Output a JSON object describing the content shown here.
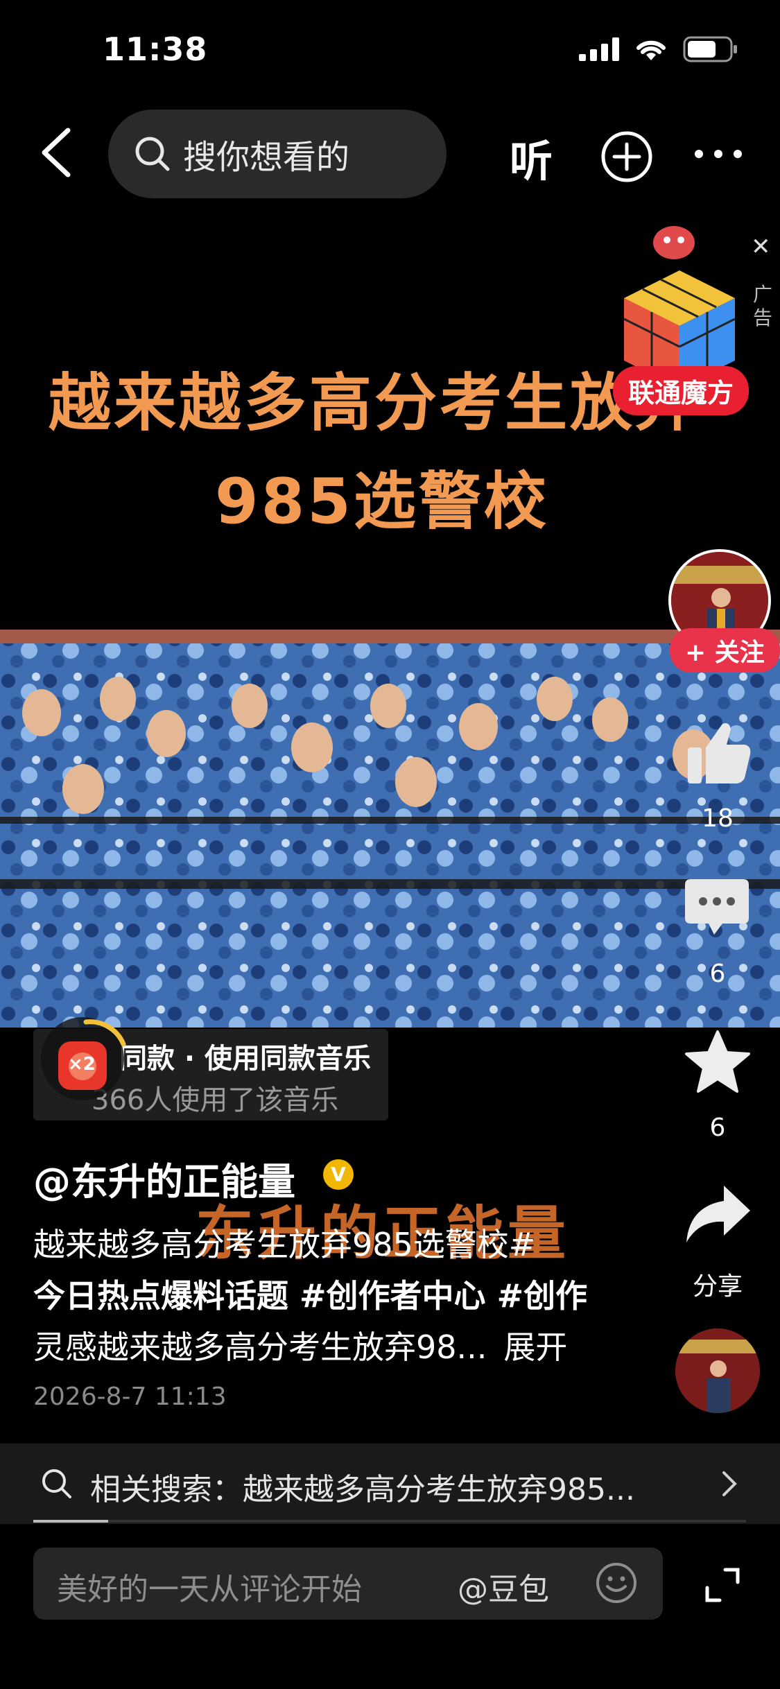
{
  "status": {
    "time": "11:38"
  },
  "nav": {
    "search_placeholder": "搜你想看的",
    "listen_label": "听"
  },
  "video": {
    "headline_line1": "越来越多高分考生放弃",
    "headline_line2": "985选警校"
  },
  "ad": {
    "brand": "联通魔方",
    "tag": "广告"
  },
  "rail": {
    "follow_label": "+ 关注",
    "like_count": "18",
    "comment_count": "6",
    "favorite_count": "6",
    "share_label": "分享"
  },
  "music": {
    "line1": "同款 · 使用同款音乐",
    "line2": "366人使用了该音乐"
  },
  "boost": {
    "label": "×2"
  },
  "post": {
    "author": "@东升的正能量",
    "verified_mark": "V",
    "watermark": "东升的正能量",
    "caption_line1": "越来越多高分考生放弃985选警校#",
    "caption_line2": "今日热点爆料话题 #创作者中心 #创作",
    "caption_line3": "灵感越来越多高分考生放弃98...",
    "expand_label": "展开",
    "date": "2026-8-7 11:13"
  },
  "related": {
    "text": "相关搜索：越来越多高分考生放弃985..."
  },
  "comment": {
    "placeholder": "美好的一天从评论开始",
    "mention": "@豆包"
  },
  "colors": {
    "accent_orange": "#f39a52",
    "follow_red": "#e8334a",
    "ad_red": "#e8202f"
  }
}
